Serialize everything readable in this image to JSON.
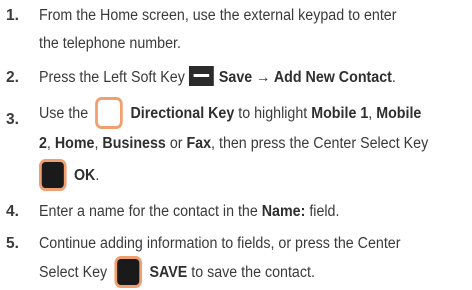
{
  "steps": [
    {
      "number": "1.",
      "line1": "From the Home screen, use the external keypad to enter",
      "line2": "the telephone number."
    },
    {
      "number": "2.",
      "pre": "Press the Left Soft Key",
      "bold": "Save → Add New Contact",
      "post": "."
    },
    {
      "number": "3.",
      "pre": "Use the",
      "bold_key": "Directional Key",
      "mid": "to highlight",
      "opt1": "Mobile 1",
      "sep1": ",",
      "opt2a": "Mobile",
      "opt2b": "2",
      "sep2": ",",
      "opt3": "Home",
      "sep3": ",",
      "opt4": "Business",
      "or": "or",
      "opt5": "Fax",
      "line2_post": ", then press the Center Select Key",
      "ok": "OK",
      "end": "."
    },
    {
      "number": "4.",
      "pre": "Enter a name for the contact in the",
      "bold": "Name:",
      "post": "field."
    },
    {
      "number": "5.",
      "line1": "Continue adding information to fields, or press the Center",
      "pre2": "Select Key",
      "bold": "SAVE",
      "post": "to save the contact."
    }
  ],
  "icons": {
    "soft_key": "left-soft-key-icon",
    "directional_key": "directional-key-icon",
    "center_select_key": "center-select-key-icon"
  }
}
